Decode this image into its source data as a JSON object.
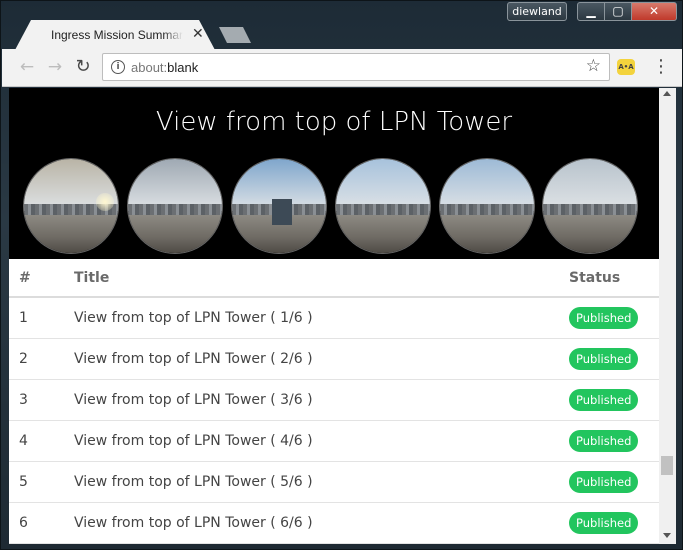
{
  "window": {
    "profile_name": "diewland",
    "min_glyph": "▁",
    "max_glyph": "▢",
    "close_glyph": "✕"
  },
  "tab": {
    "title": "Ingress Mission Summary",
    "close_glyph": "✕"
  },
  "toolbar": {
    "back_glyph": "←",
    "forward_glyph": "→",
    "reload_glyph": "↻",
    "info_glyph": "i",
    "url_scheme": "about:",
    "url_rest": "blank",
    "star_glyph": "☆",
    "extension_label": "A•A",
    "menu_glyph": "⋮"
  },
  "hero": {
    "title": "View from top of LPN Tower",
    "photos": [
      {
        "name": "photo-1",
        "sky": "#b9b4a6",
        "icon": "panorama-photo"
      },
      {
        "name": "photo-2",
        "sky": "#9fa9b3",
        "icon": "panorama-photo"
      },
      {
        "name": "photo-3",
        "sky": "#7fa6cc",
        "icon": "panorama-photo"
      },
      {
        "name": "photo-4",
        "sky": "#a7c2dc",
        "icon": "panorama-photo"
      },
      {
        "name": "photo-5",
        "sky": "#9dbad6",
        "icon": "panorama-photo"
      },
      {
        "name": "photo-6",
        "sky": "#b8c3cc",
        "icon": "panorama-photo"
      }
    ]
  },
  "table": {
    "headers": {
      "num": "#",
      "title": "Title",
      "status": "Status"
    },
    "rows": [
      {
        "num": "1",
        "title": "View from top of LPN Tower ( 1/6 )",
        "status": "Published"
      },
      {
        "num": "2",
        "title": "View from top of LPN Tower ( 2/6 )",
        "status": "Published"
      },
      {
        "num": "3",
        "title": "View from top of LPN Tower ( 3/6 )",
        "status": "Published"
      },
      {
        "num": "4",
        "title": "View from top of LPN Tower ( 4/6 )",
        "status": "Published"
      },
      {
        "num": "5",
        "title": "View from top of LPN Tower ( 5/6 )",
        "status": "Published"
      },
      {
        "num": "6",
        "title": "View from top of LPN Tower ( 6/6 )",
        "status": "Published"
      }
    ]
  },
  "colors": {
    "badge": "#22c55e",
    "hero_bg": "#000000"
  }
}
